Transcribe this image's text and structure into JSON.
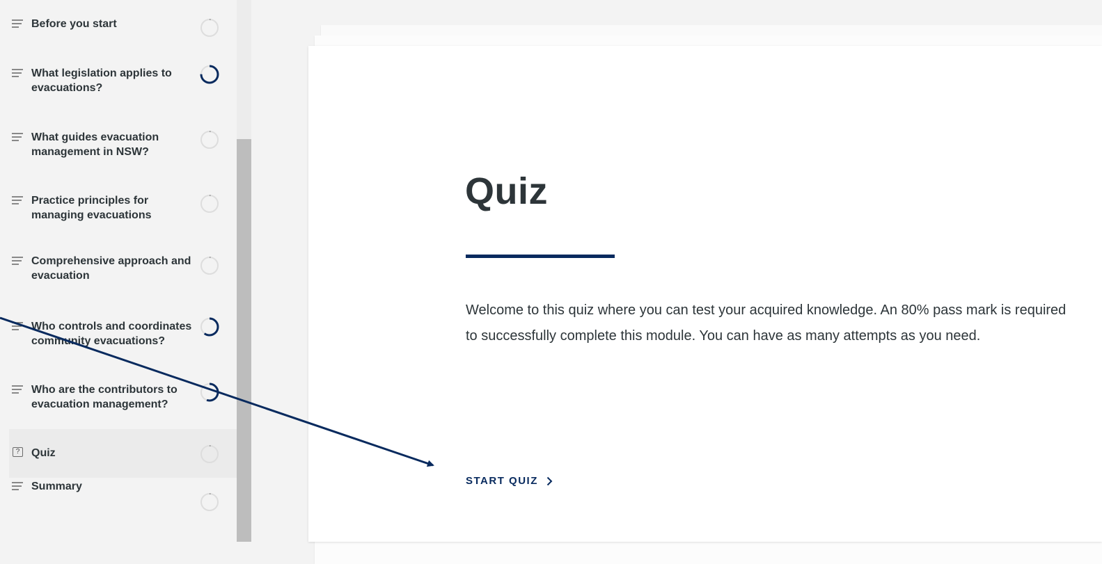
{
  "sidebar": {
    "lessons": [
      {
        "label": "Before you start",
        "type": "text",
        "icon": "lines-icon",
        "progress": 0.02
      },
      {
        "label": "What legislation applies to evacuations?",
        "type": "text",
        "icon": "lines-icon",
        "progress": 0.75
      },
      {
        "label": "What guides evacuation management in NSW?",
        "type": "text",
        "icon": "lines-icon",
        "progress": 0.02
      },
      {
        "label": "Practice principles for managing evacuations",
        "type": "text",
        "icon": "lines-icon",
        "progress": 0.02
      },
      {
        "label": "Comprehensive approach and evacuation",
        "type": "text",
        "icon": "lines-icon",
        "progress": 0.02
      },
      {
        "label": "Who controls and coordinates community evacuations?",
        "type": "text",
        "icon": "lines-icon",
        "progress": 0.6
      },
      {
        "label": "Who are the contributors to evacuation management?",
        "type": "text",
        "icon": "lines-icon",
        "progress": 0.55
      },
      {
        "label": "Quiz",
        "type": "quiz",
        "icon": "question-box-icon",
        "qmark": "?",
        "progress": 0.02,
        "active": true
      },
      {
        "label": "Summary",
        "type": "text",
        "icon": "lines-icon",
        "progress": 0.02
      }
    ]
  },
  "main": {
    "title": "Quiz",
    "intro": "Welcome to this quiz where you can test your acquired knowledge. An 80% pass mark is required to successfully complete this module. You can have as many attempts as you need.",
    "start_label": "START QUIZ"
  },
  "colors": {
    "accent": "#082a5e",
    "text": "#2d3539",
    "sidebar_bg": "#f3f3f3",
    "active_bg": "#ebebeb",
    "ring_track": "#dddddd"
  }
}
